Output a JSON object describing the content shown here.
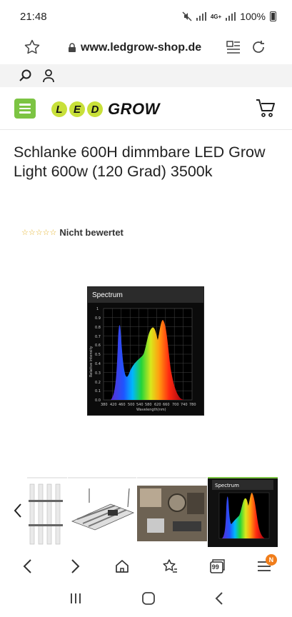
{
  "status": {
    "time": "21:48",
    "network": "4G+",
    "battery": "100%"
  },
  "browser": {
    "url": "www.ledgrow-shop.de",
    "tab_count": "99",
    "notification_badge": "N"
  },
  "site": {
    "logo_letters": [
      "L",
      "E",
      "D"
    ],
    "logo_word": "GROW",
    "accent_color": "#7cc443"
  },
  "product": {
    "title": "Schlanke 600H dimmbare LED Grow Light 600w (120 Grad) 3500k",
    "rating_stars": "☆☆☆☆☆",
    "rating_text": "Nicht bewertet"
  },
  "image": {
    "caption": "Spectrum",
    "x_label": "Wavelength(nm)",
    "y_label": "Relative intensity",
    "y_ticks": [
      "1",
      "0.9",
      "0.8",
      "0.7",
      "0.6",
      "0.5",
      "0.4",
      "0.3",
      "0.2",
      "0.1",
      "0.0"
    ],
    "x_ticks": [
      "380",
      "420",
      "460",
      "500",
      "540",
      "580",
      "620",
      "660",
      "700",
      "740",
      "780"
    ]
  },
  "thumbnails": {
    "active_caption": "Spectrum"
  }
}
